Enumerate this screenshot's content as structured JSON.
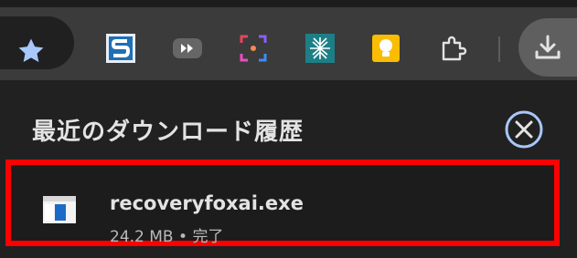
{
  "toolbar": {
    "extensions": [
      "s-extension-icon",
      "video-speed-extension-icon",
      "screenshot-extension-icon",
      "network-extension-icon",
      "keep-bulb-extension-icon",
      "puzzle-extensions-icon"
    ]
  },
  "downloads": {
    "title": "最近のダウンロード履歴",
    "items": [
      {
        "name": "recoveryfoxai.exe",
        "size": "24.2 MB",
        "separator": "•",
        "status": "完了"
      }
    ]
  },
  "colors": {
    "highlight": "#ff0000",
    "accent": "#a8c7fa"
  }
}
